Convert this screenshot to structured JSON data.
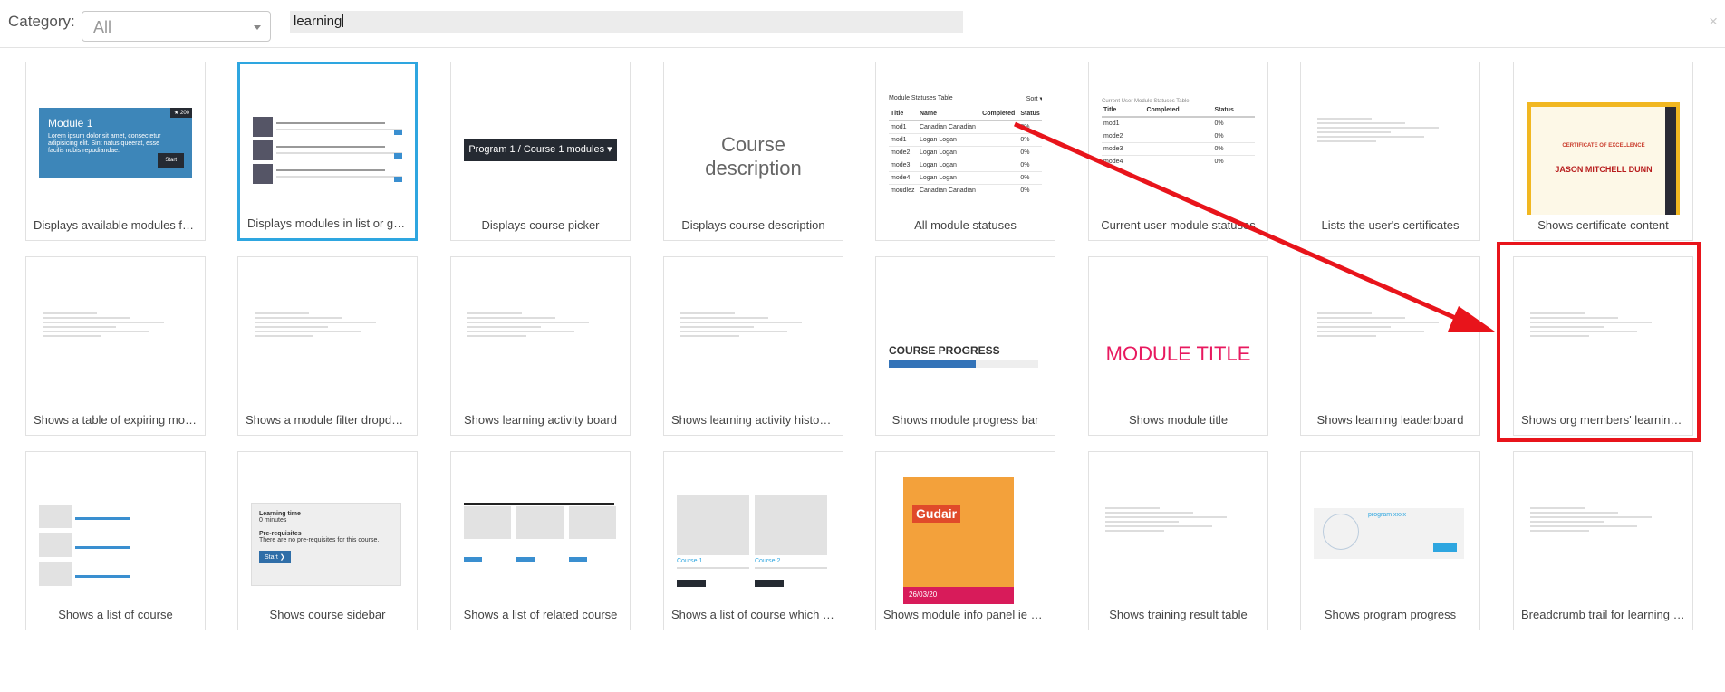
{
  "filter": {
    "category_label": "Category:",
    "category_value": "All",
    "search_value": "learning",
    "close_glyph": "×"
  },
  "tiles": [
    {
      "caption": "Displays available modules for the user",
      "thumb": "module-card"
    },
    {
      "caption": "Displays modules in list or grid view",
      "thumb": "module-list"
    },
    {
      "caption": "Displays course picker",
      "thumb": "course-picker"
    },
    {
      "caption": "Displays course description",
      "thumb": "course-description"
    },
    {
      "caption": "All module statuses",
      "thumb": "module-statuses-table"
    },
    {
      "caption": "Current user module statuses",
      "thumb": "current-user-statuses-table"
    },
    {
      "caption": "Lists the user's certificates",
      "thumb": "certificates-list"
    },
    {
      "caption": "Shows certificate content",
      "thumb": "certificate"
    },
    {
      "caption": "Shows a table of expiring modules",
      "thumb": "expiring-table"
    },
    {
      "caption": "Shows a module filter dropdown",
      "thumb": "filter-dropdown"
    },
    {
      "caption": "Shows learning activity board",
      "thumb": "activity-board"
    },
    {
      "caption": "Shows learning activity histogram",
      "thumb": "histogram"
    },
    {
      "caption": "Shows module progress bar",
      "thumb": "progress-bar"
    },
    {
      "caption": "Shows module title",
      "thumb": "module-title"
    },
    {
      "caption": "Shows learning leaderboard",
      "thumb": "leaderboard"
    },
    {
      "caption": "Shows org members' learning progress",
      "thumb": "org-members"
    },
    {
      "caption": "Shows a list of course",
      "thumb": "course-list"
    },
    {
      "caption": "Shows course sidebar",
      "thumb": "course-sidebar"
    },
    {
      "caption": "Shows a list of related course",
      "thumb": "related-course"
    },
    {
      "caption": "Shows a list of course which has points",
      "thumb": "course-points"
    },
    {
      "caption": "Shows module info panel ie expiry date",
      "thumb": "info-panel"
    },
    {
      "caption": "Shows training result table",
      "thumb": "training-result"
    },
    {
      "caption": "Shows program progress",
      "thumb": "program-progress"
    },
    {
      "caption": "Breadcrumb trail for learning pages",
      "thumb": "breadcrumb"
    }
  ],
  "thumb_text": {
    "module_card_title": "Module 1",
    "module_card_desc": "Lorem ipsum dolor sit amet, consectetur adipisicing elit. Sint natus queerat, esse facilis nobis repudiandae.",
    "module_card_button": "Start",
    "module_card_badge": "★ 200",
    "course_picker_button": "Program 1 / Course 1 modules ▾",
    "course_description": "Course description",
    "statuses_title": "Module Statuses Table",
    "statuses_sort": "Sort ▾",
    "statuses_headers": [
      "Title",
      "Name",
      "Completed",
      "Status"
    ],
    "statuses_rows": [
      [
        "mod1",
        "Canadian Canadian",
        "",
        "0%"
      ],
      [
        "mod1",
        "Logan Logan",
        "",
        "0%"
      ],
      [
        "mode2",
        "Logan Logan",
        "",
        "0%"
      ],
      [
        "mode3",
        "Logan Logan",
        "",
        "0%"
      ],
      [
        "mode4",
        "Logan Logan",
        "",
        "0%"
      ],
      [
        "moudlez",
        "Canadian Canadian",
        "",
        "0%"
      ]
    ],
    "current_title": "Current User Module Statuses Table",
    "current_headers": [
      "Title",
      "Completed",
      "Status"
    ],
    "current_rows": [
      [
        "mod1",
        "",
        "0%"
      ],
      [
        "mode2",
        "",
        "0%"
      ],
      [
        "mode3",
        "",
        "0%"
      ],
      [
        "mode4",
        "",
        "0%"
      ]
    ],
    "cert_heading": "CERTIFICATE OF EXCELLENCE",
    "cert_name": "JASON MITCHELL DUNN",
    "progress_label": "COURSE PROGRESS",
    "module_title": "MODULE TITLE",
    "sidebar_learning_time": "Learning time",
    "sidebar_minutes": "0 minutes",
    "sidebar_prereq": "Pre-requisites",
    "sidebar_prereq_text": "There are no pre-requisites for this course.",
    "sidebar_start": "Start ❯",
    "info_brand": "Gudair",
    "info_expiry": "26/03/20",
    "course1": "Course 1",
    "course2": "Course 2",
    "program_name": "program xxxx"
  },
  "colors": {
    "selected_border": "#2ea6e0",
    "highlight": "#e8141b",
    "accent_blue": "#3d86b9",
    "module_title": "#e8195f"
  }
}
